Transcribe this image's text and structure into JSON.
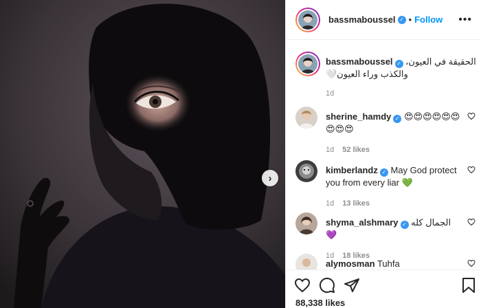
{
  "post": {
    "username": "bassmaboussel",
    "follow_label": "Follow",
    "separator": "•",
    "caption": "الحقيقة في العيون، والكذب وراء العيون🤍",
    "caption_time": "1d",
    "likes": "88,338 likes"
  },
  "comments": [
    {
      "username": "sherine_hamdy",
      "verified": true,
      "text": "😍😍😍😍😍😍😍😍😍",
      "time": "1d",
      "likes": "52 likes"
    },
    {
      "username": "kimberlandz",
      "verified": true,
      "text": "May God protect you from every liar 💚",
      "time": "1d",
      "likes": "13 likes"
    },
    {
      "username": "shyma_alshmary",
      "verified": true,
      "text": "الجمال كله 💜",
      "time": "1d",
      "likes": "18 likes"
    },
    {
      "username": "alymosman",
      "verified": false,
      "text": "Tuhfa",
      "time": "",
      "likes": ""
    }
  ],
  "icons": {
    "next": "chevron-right-icon",
    "more": "more-options-icon",
    "like": "heart-icon",
    "comment": "comment-icon",
    "share": "paper-plane-icon",
    "save": "bookmark-icon",
    "verified": "verified-badge-icon"
  },
  "colors": {
    "accent": "#0095f6",
    "verified": "#3897f0",
    "text": "#262626",
    "muted": "#8e8e8e"
  }
}
